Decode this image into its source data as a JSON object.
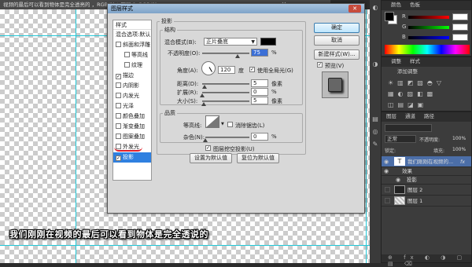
{
  "canvas": {
    "title": "视频的最后可以看到物体是完全透亮的 ，RGB/8) * 图层 0, RGB/8)",
    "close_glyph": "✕",
    "overlay_text": "我们刚刚在视频的最后可以看到物体是完全透说的"
  },
  "dialog": {
    "title": "图层样式",
    "close_glyph": "✕",
    "styles_header": "样式",
    "blend_options": "混合选项:默认",
    "style_items": [
      {
        "label": "斜面和浮雕",
        "checked": false,
        "indent": false
      },
      {
        "label": "等高线",
        "checked": false,
        "indent": true
      },
      {
        "label": "纹理",
        "checked": false,
        "indent": true
      },
      {
        "label": "描边",
        "checked": true,
        "indent": false
      },
      {
        "label": "内阴影",
        "checked": false,
        "indent": false
      },
      {
        "label": "内发光",
        "checked": false,
        "indent": false
      },
      {
        "label": "光泽",
        "checked": false,
        "indent": false
      },
      {
        "label": "颜色叠加",
        "checked": false,
        "indent": false
      },
      {
        "label": "渐变叠加",
        "checked": false,
        "indent": false
      },
      {
        "label": "图案叠加",
        "checked": false,
        "indent": false
      },
      {
        "label": "外发光",
        "checked": false,
        "indent": false
      },
      {
        "label": "投影",
        "checked": true,
        "indent": false,
        "selected": true
      }
    ],
    "section_title": "投影",
    "structure_title": "结构",
    "blend_mode_label": "混合模式(B):",
    "blend_mode_value": "正片叠底",
    "shadow_color": "#000000",
    "opacity_label": "不透明度(O):",
    "opacity_value": "75",
    "pct": "%",
    "angle_label": "角度(A):",
    "angle_value": "120",
    "degree": "度",
    "global_light_label": "使用全局光(G)",
    "global_light_checked": true,
    "distance_label": "距离(D):",
    "distance_value": "5",
    "spread_label": "扩展(R):",
    "spread_value": "0",
    "size_label": "大小(S):",
    "size_value": "5",
    "px": "像素",
    "quality_title": "品质",
    "contour_label": "等高线:",
    "antialias_label": "消除锯齿(L)",
    "noise_label": "杂色(N):",
    "noise_value": "0",
    "knockout_label": "图层挖空投影(U)",
    "knockout_checked": true,
    "make_default": "设置为默认值",
    "reset_default": "复位为默认值",
    "ok_button": "确定",
    "cancel_button": "取消",
    "new_style_button": "新建样式(W)...",
    "preview_label": "预览(V)",
    "preview_checked": true
  },
  "right": {
    "color_tab": "颜色",
    "swatches_tab": "色板",
    "channels": [
      {
        "label": "R",
        "value": "",
        "color": "#e04040"
      },
      {
        "label": "G",
        "value": "",
        "color": "#40c040"
      },
      {
        "label": "B",
        "value": "",
        "color": "#4060e0"
      }
    ],
    "adjust_tab": "调整",
    "styles_tab": "样式",
    "adjust_title": "添加调整",
    "layers_tab": "图层",
    "channels_tab": "通道",
    "paths_tab": "路径",
    "blend_mode": "正常",
    "opacity_label": "不透明度:",
    "opacity_value": "100%",
    "lock_label": "锁定:",
    "fill_label": "填充:",
    "fill_value": "100%",
    "layers": [
      {
        "name": "我们刚刚在视频的...",
        "type": "text",
        "selected": true,
        "fx": "fx"
      },
      {
        "name": "效果",
        "type": "effect"
      },
      {
        "name": "投影",
        "type": "effect-item"
      },
      {
        "name": "图层 2",
        "type": "image"
      },
      {
        "name": "图层 1",
        "type": "image"
      }
    ]
  }
}
